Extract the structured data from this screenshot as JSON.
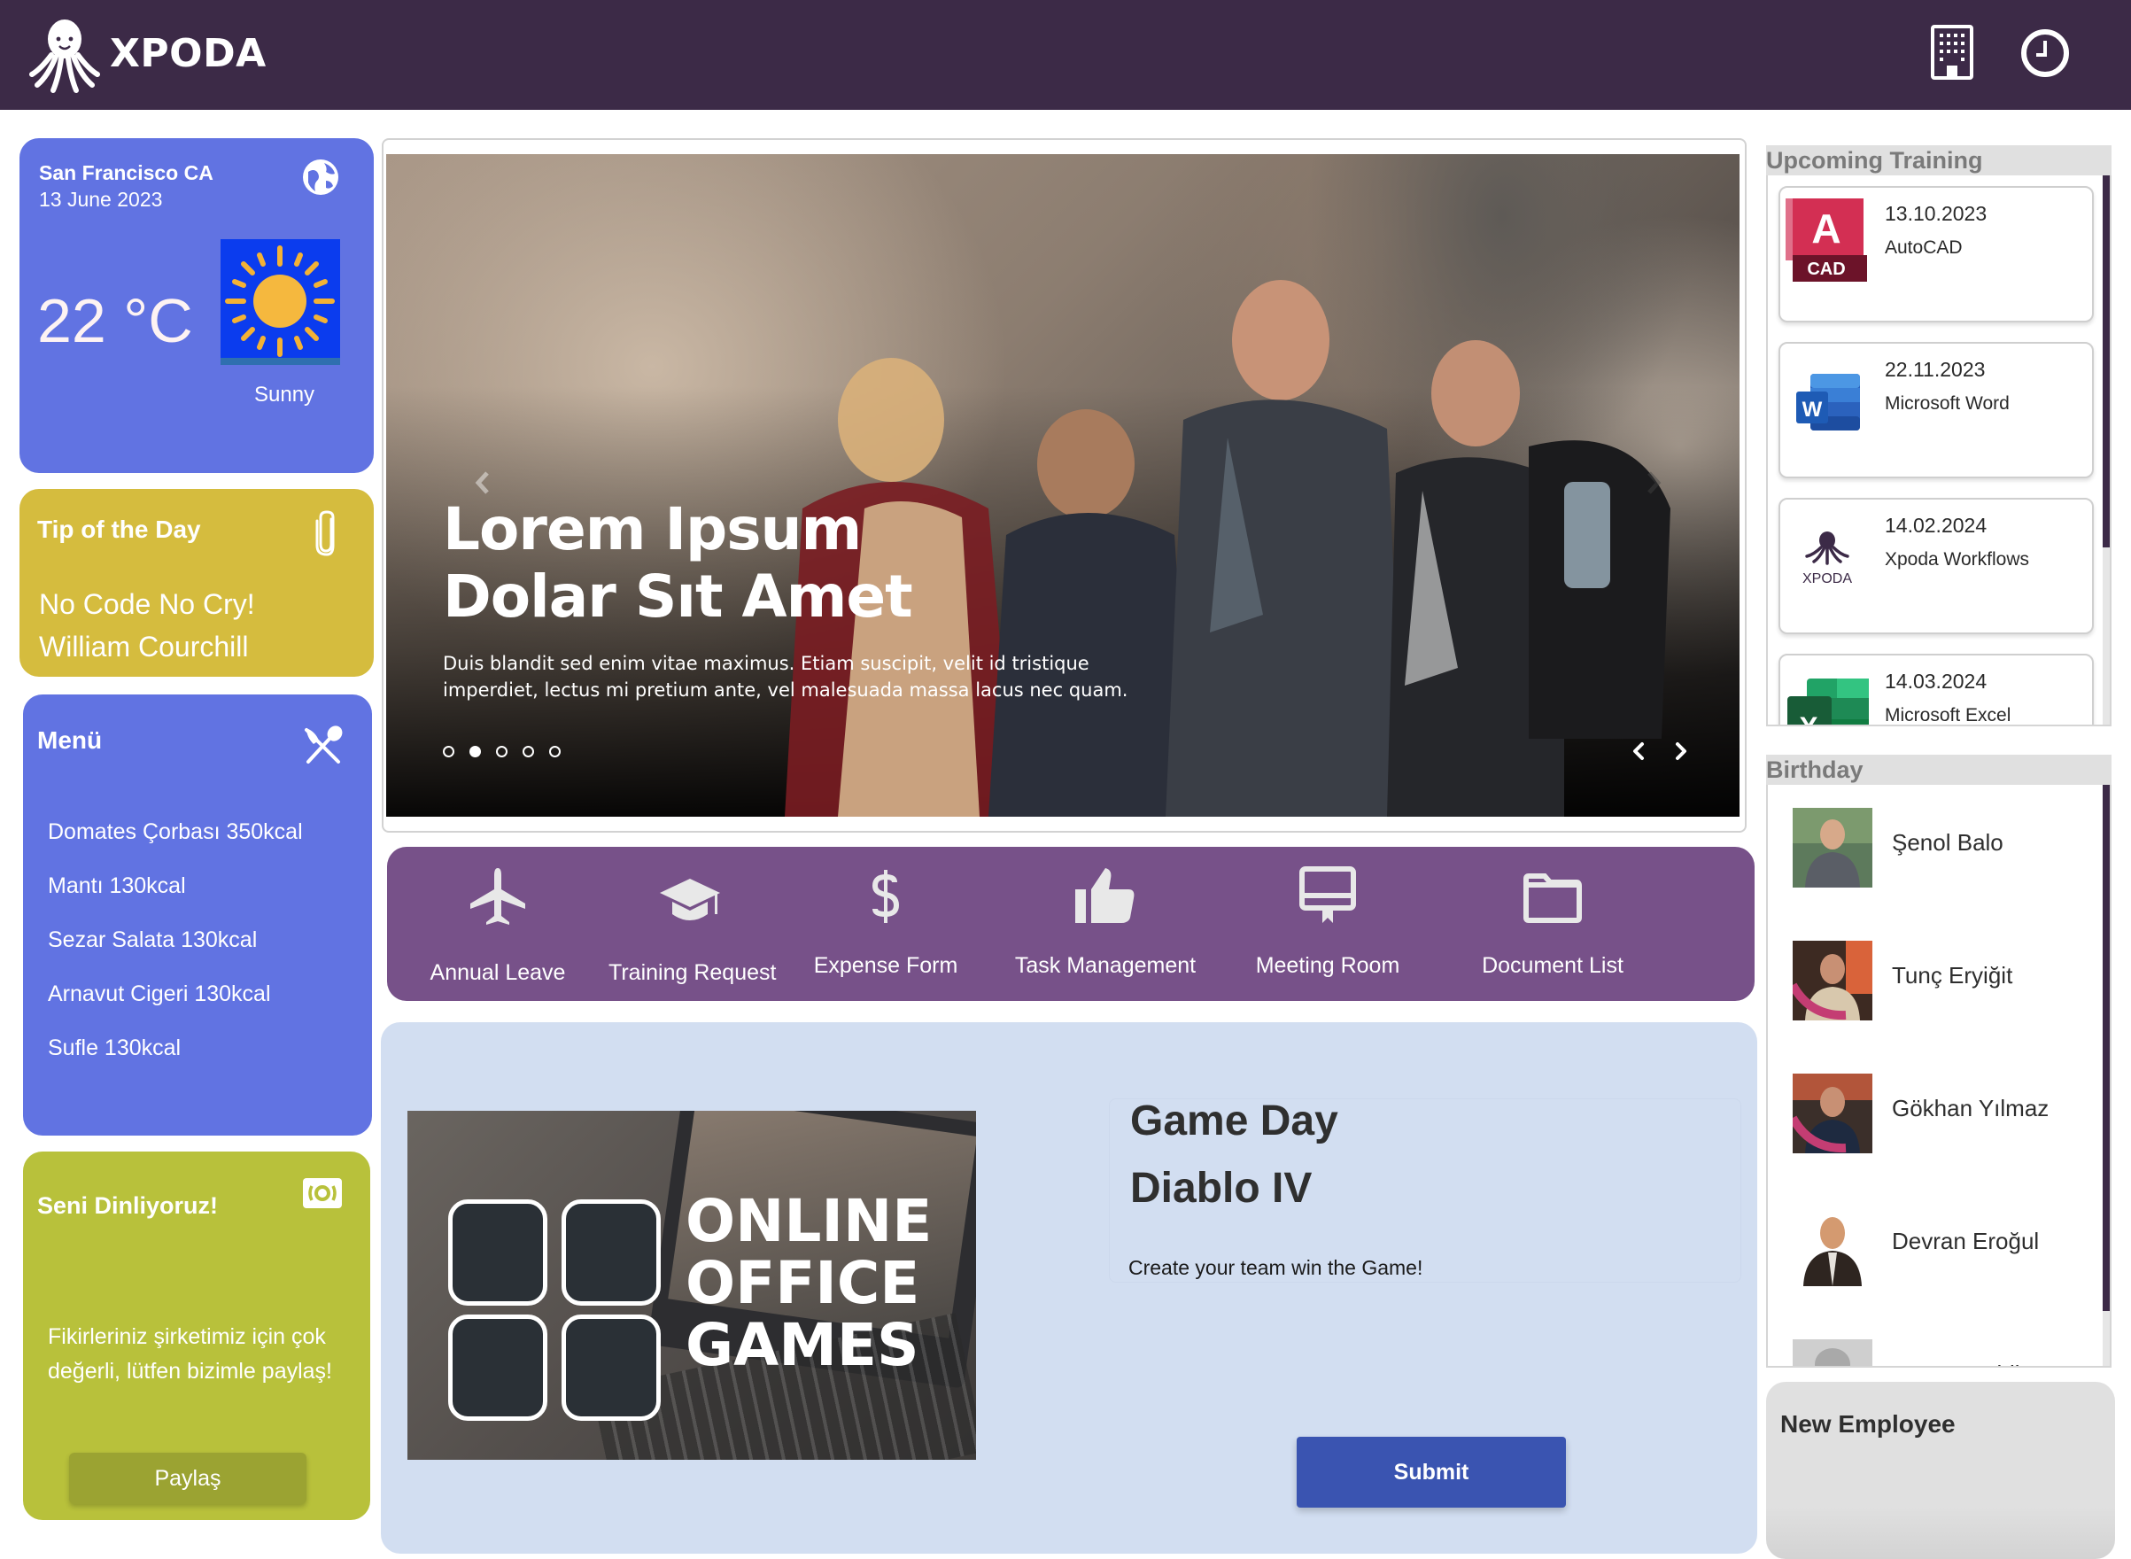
{
  "header": {
    "brand": "XPODA",
    "icons": [
      "building-icon",
      "clock-icon"
    ]
  },
  "weather": {
    "city": "San Francisco CA",
    "date": "13 June 2023",
    "temperature": "22 °C",
    "condition": "Sunny",
    "icon": "globe-icon"
  },
  "tip": {
    "title": "Tip of the Day",
    "quote_line1": "No Code No Cry!",
    "quote_line2": "William Courchill",
    "icon": "paperclip-icon"
  },
  "menu": {
    "title": "Menü",
    "icon": "cutlery-icon",
    "items": [
      "Domates Çorbası 350kcal",
      "Mantı 130kcal",
      "Sezar Salata 130kcal",
      "Arnavut Cigeri 130kcal",
      "Sufle 130kcal"
    ]
  },
  "feedback": {
    "title": "Seni Dinliyoruz!",
    "description": "Fikirleriniz şirketimiz için çok değerli, lütfen bizimle paylaş!",
    "button": "Paylaş",
    "icon": "camera-icon"
  },
  "carousel": {
    "headline_line1": "Lorem Ipsum",
    "headline_line2": "Dolar Sıt Amet",
    "subtext": "Duis blandit sed enim vitae maximus. Etiam suscipit, velit id tristique imperdiet, lectus mi pretium ante, vel malesuada massa lacus nec quam.",
    "slide_count": 5,
    "active_slide": 2
  },
  "quick_links": [
    {
      "label": "Annual Leave",
      "icon": "airplane-icon"
    },
    {
      "label": "Training Request",
      "icon": "graduation-cap-icon"
    },
    {
      "label": "Expense Form",
      "icon": "dollar-icon"
    },
    {
      "label": "Task Management",
      "icon": "thumbs-up-icon"
    },
    {
      "label": "Meeting Room",
      "icon": "presentation-board-icon"
    },
    {
      "label": "Document List",
      "icon": "folder-icon"
    }
  ],
  "event": {
    "poster_text": [
      "ONLINE",
      "OFFICE",
      "GAMES"
    ],
    "title": "Game Day",
    "subtitle": "Diablo IV",
    "description": "Create your team win the Game!",
    "submit": "Submit"
  },
  "upcoming_training": {
    "title": "Upcoming Training",
    "items": [
      {
        "date": "13.10.2023",
        "name": "AutoCAD",
        "icon": "autocad-icon",
        "icon_text": "CAD"
      },
      {
        "date": "22.11.2023",
        "name": "Microsoft Word",
        "icon": "word-icon",
        "icon_text": "W"
      },
      {
        "date": "14.02.2024",
        "name": "Xpoda Workflows",
        "icon": "xpoda-icon",
        "icon_text": "XPODA"
      },
      {
        "date": "14.03.2024",
        "name": "Microsoft Excel",
        "icon": "excel-icon",
        "icon_text": "X"
      }
    ]
  },
  "birthday": {
    "title": "Birthday",
    "people": [
      {
        "name": "Şenol Balo"
      },
      {
        "name": "Tunç Eryiğit"
      },
      {
        "name": "Gökhan Yılmaz"
      },
      {
        "name": "Devran Eroğul"
      },
      {
        "name": "Intenet Public"
      }
    ]
  },
  "new_employee": {
    "title": "New Employee"
  },
  "colors": {
    "header": "#3c2a47",
    "weather_card": "#6173e2",
    "tip_card": "#d5bc3e",
    "feedback_card": "#b8c13b",
    "quick_links": "#775189",
    "event_panel": "#d2def1",
    "submit_button": "#3a54b1"
  }
}
